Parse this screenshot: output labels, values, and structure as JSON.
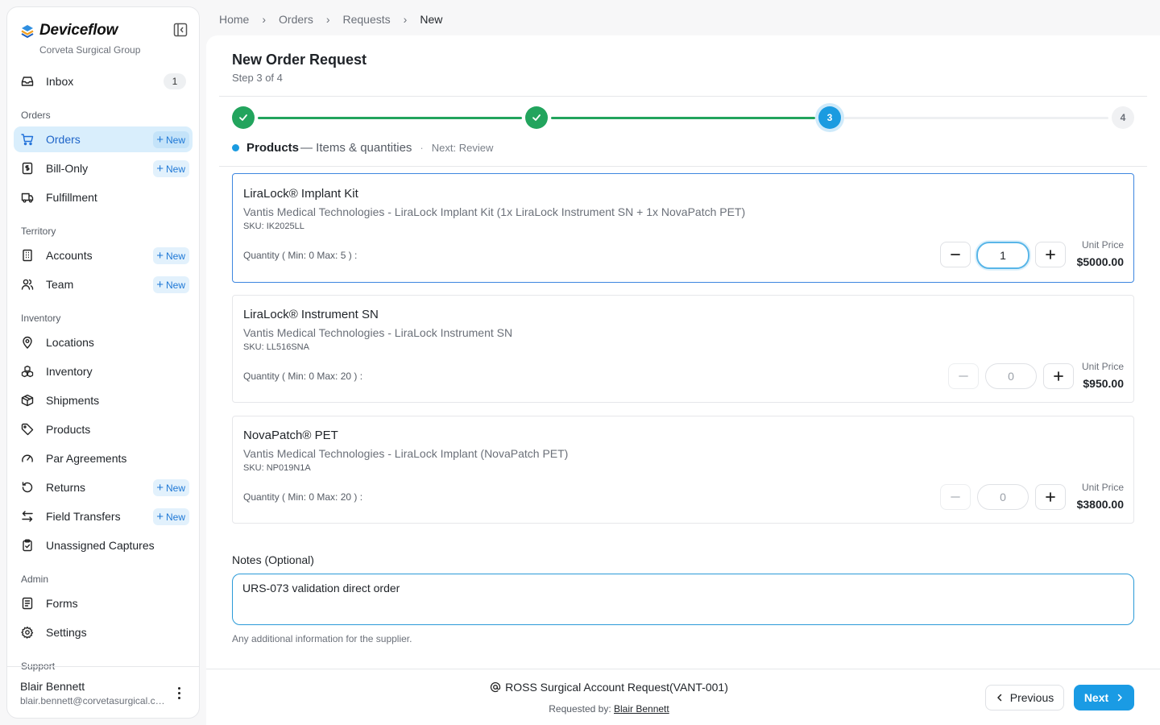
{
  "brand": {
    "name": "Deviceflow",
    "org": "Corveta Surgical Group"
  },
  "sidebar": {
    "inbox": {
      "label": "Inbox",
      "count": "1"
    },
    "sections": {
      "orders": "Orders",
      "territory": "Territory",
      "inventory": "Inventory",
      "admin": "Admin",
      "support": "Support"
    },
    "items": {
      "orders": {
        "label": "Orders",
        "new": "New",
        "icon": "cart-icon",
        "active": true
      },
      "bill_only": {
        "label": "Bill-Only",
        "new": "New",
        "icon": "receipt-icon"
      },
      "fulfillment": {
        "label": "Fulfillment",
        "icon": "truck-icon"
      },
      "accounts": {
        "label": "Accounts",
        "new": "New",
        "icon": "building-icon"
      },
      "team": {
        "label": "Team",
        "new": "New",
        "icon": "users-icon"
      },
      "locations": {
        "label": "Locations",
        "icon": "map-pin-icon"
      },
      "inventory": {
        "label": "Inventory",
        "icon": "boxes-icon"
      },
      "shipments": {
        "label": "Shipments",
        "icon": "package-icon"
      },
      "products": {
        "label": "Products",
        "icon": "tag-icon"
      },
      "par_agreements": {
        "label": "Par Agreements",
        "icon": "gauge-icon"
      },
      "returns": {
        "label": "Returns",
        "new": "New",
        "icon": "undo-icon"
      },
      "field_transfers": {
        "label": "Field Transfers",
        "new": "New",
        "icon": "transfer-icon"
      },
      "unassigned_captures": {
        "label": "Unassigned Captures",
        "icon": "clipboard-check-icon"
      },
      "forms": {
        "label": "Forms",
        "icon": "form-icon"
      },
      "settings": {
        "label": "Settings",
        "icon": "gear-icon"
      }
    },
    "user": {
      "name": "Blair Bennett",
      "email": "blair.bennett@corvetasurgical.com"
    }
  },
  "breadcrumb": [
    "Home",
    "Orders",
    "Requests",
    "New"
  ],
  "page": {
    "title": "New Order Request",
    "step": "Step 3 of 4"
  },
  "stepper": {
    "current_step": 3,
    "total_steps": 4,
    "step3_label": "3",
    "step4_label": "4",
    "current_name": "Products",
    "current_desc": "— Items & quantities",
    "separator": "·",
    "next": "Next: Review"
  },
  "products": [
    {
      "name": "LiraLock® Implant Kit",
      "description": "Vantis Medical Technologies - LiraLock Implant Kit (1x LiraLock Instrument SN + 1x NovaPatch PET)",
      "sku": "SKU: IK2025LL",
      "quantity_label": "Quantity  ( Min: 0 Max: 5 ) :",
      "quantity": "1",
      "unit_price_label": "Unit Price",
      "unit_price": "$5000.00"
    },
    {
      "name": "LiraLock® Instrument SN",
      "description": "Vantis Medical Technologies - LiraLock Instrument SN",
      "sku": "SKU: LL516SNA",
      "quantity_label": "Quantity  ( Min: 0 Max: 20 ) :",
      "quantity": "0",
      "unit_price_label": "Unit Price",
      "unit_price": "$950.00"
    },
    {
      "name": "NovaPatch® PET",
      "description": "Vantis Medical Technologies - LiraLock Implant (NovaPatch PET)",
      "sku": "SKU: NP019N1A",
      "quantity_label": "Quantity  ( Min: 0 Max: 20 ) :",
      "quantity": "0",
      "unit_price_label": "Unit Price",
      "unit_price": "$3800.00"
    }
  ],
  "notes": {
    "label": "Notes (Optional)",
    "value": "URS-073 validation direct order",
    "help": "Any additional information for the supplier."
  },
  "footer": {
    "account": "ROSS Surgical Account Request(VANT-001)",
    "requested_by_label": "Requested by:",
    "requested_by": "Blair Bennett",
    "prev": "Previous",
    "next": "Next"
  },
  "colors": {
    "accent": "#1a9be4",
    "success": "#22a45d",
    "active_nav_bg": "#d9eefc"
  }
}
